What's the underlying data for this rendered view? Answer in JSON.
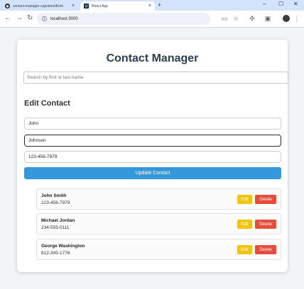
{
  "browser": {
    "tabs": [
      {
        "title": "contact-manager-capstone/front",
        "active": false
      },
      {
        "title": "React App",
        "active": true
      }
    ],
    "url": "localhost:3000"
  },
  "app": {
    "title": "Contact Manager",
    "search_placeholder": "Search by first or last name",
    "search_value": ""
  },
  "form": {
    "heading": "Edit Contact",
    "first_name": "John",
    "last_name": "Johnson",
    "phone": "123-456-7979",
    "submit_label": "Update Contact"
  },
  "contacts": [
    {
      "name": "John Smith",
      "phone": "123-456-7979"
    },
    {
      "name": "Michael Jordan",
      "phone": "234-555-0111"
    },
    {
      "name": "George Washington",
      "phone": "612-345-1776"
    }
  ],
  "labels": {
    "edit": "Edit",
    "delete": "Delete"
  },
  "colors": {
    "primary": "#3498db",
    "edit": "#f1c40f",
    "delete": "#e74c3c",
    "title": "#2c3e50"
  }
}
